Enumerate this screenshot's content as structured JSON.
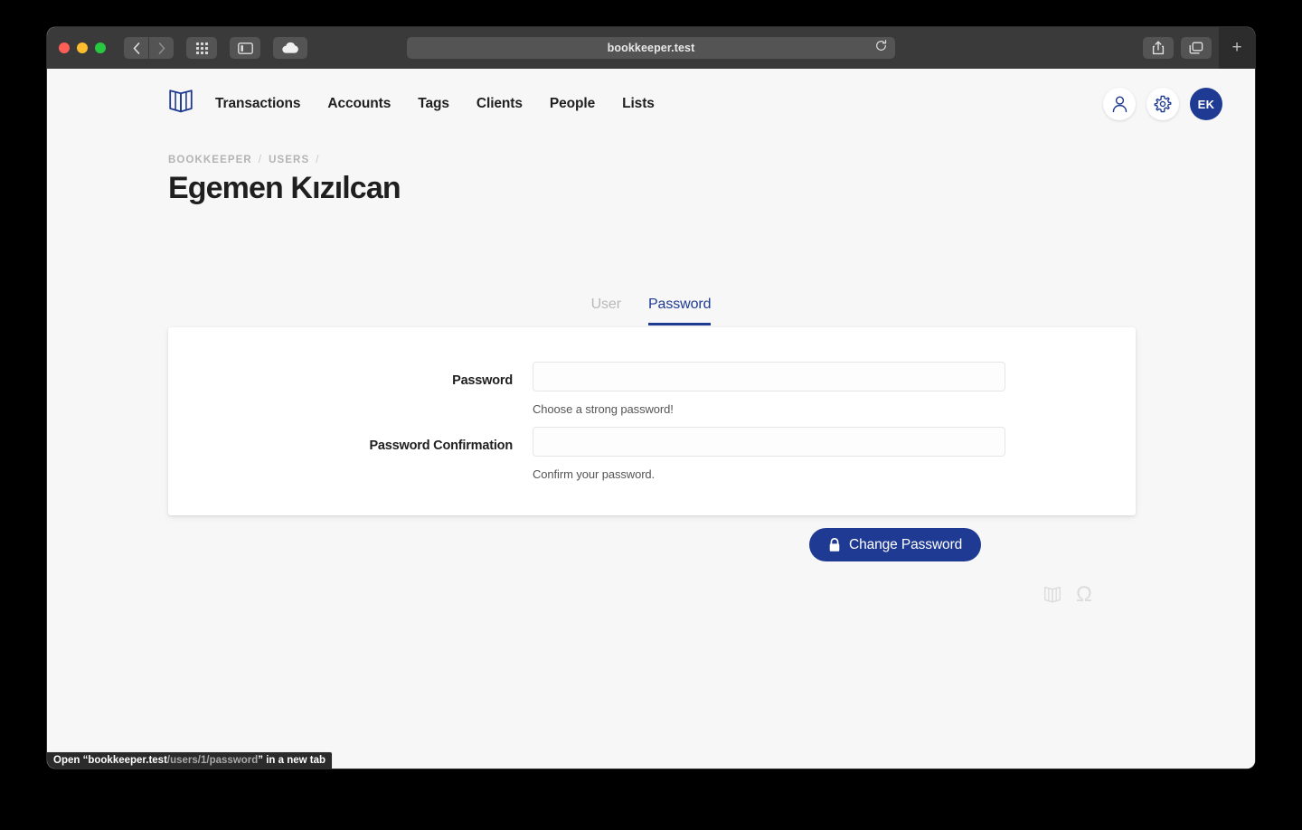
{
  "browser": {
    "url": "bookkeeper.test",
    "traffic_lights": [
      "close",
      "minimize",
      "maximize"
    ],
    "back_icon": "chevron-left-icon",
    "forward_icon": "chevron-right-icon",
    "tab_overview_icon": "grid-icon",
    "sidebar_icon": "sidebar-toggle-icon",
    "icloud_icon": "cloud-icon",
    "reload_icon": "reload-icon",
    "share_icon": "share-icon",
    "tabs_icon": "copy-tabs-icon",
    "new_tab_label": "+"
  },
  "app": {
    "logo": "open-book-logo",
    "nav": [
      {
        "label": "Transactions"
      },
      {
        "label": "Accounts"
      },
      {
        "label": "Tags"
      },
      {
        "label": "Clients"
      },
      {
        "label": "People"
      },
      {
        "label": "Lists"
      }
    ],
    "actions": {
      "profile_icon": "person-icon",
      "settings_icon": "gear-icon",
      "avatar_initials": "EK"
    }
  },
  "header": {
    "breadcrumb": [
      {
        "label": "BOOKKEEPER"
      },
      {
        "label": "USERS"
      }
    ],
    "separator": "/",
    "trailing_separator": "/",
    "title": "Egemen Kızılcan"
  },
  "tabs": [
    {
      "label": "User",
      "active": false
    },
    {
      "label": "Password",
      "active": true
    }
  ],
  "form": {
    "fields": [
      {
        "label": "Password",
        "value": "",
        "placeholder": "",
        "help": "Choose a strong password!"
      },
      {
        "label": "Password Confirmation",
        "value": "",
        "placeholder": "",
        "help": "Confirm your password."
      }
    ],
    "submit": {
      "label": "Change Password",
      "icon": "lock-icon"
    }
  },
  "footer": {
    "book_icon": "open-book-icon",
    "omega_icon": "omega-icon",
    "omega_glyph": "Ω"
  },
  "status_bar": {
    "prefix": "Open “",
    "domain": "bookkeeper.test",
    "path": "/users/1/password",
    "suffix": "” in a new tab"
  },
  "colors": {
    "brand_navy": "#1f3a93",
    "page_bg": "#f7f7f7",
    "card_bg": "#ffffff",
    "muted_text": "#b4b4b4",
    "toolbar_bg": "#3a3a3a"
  }
}
